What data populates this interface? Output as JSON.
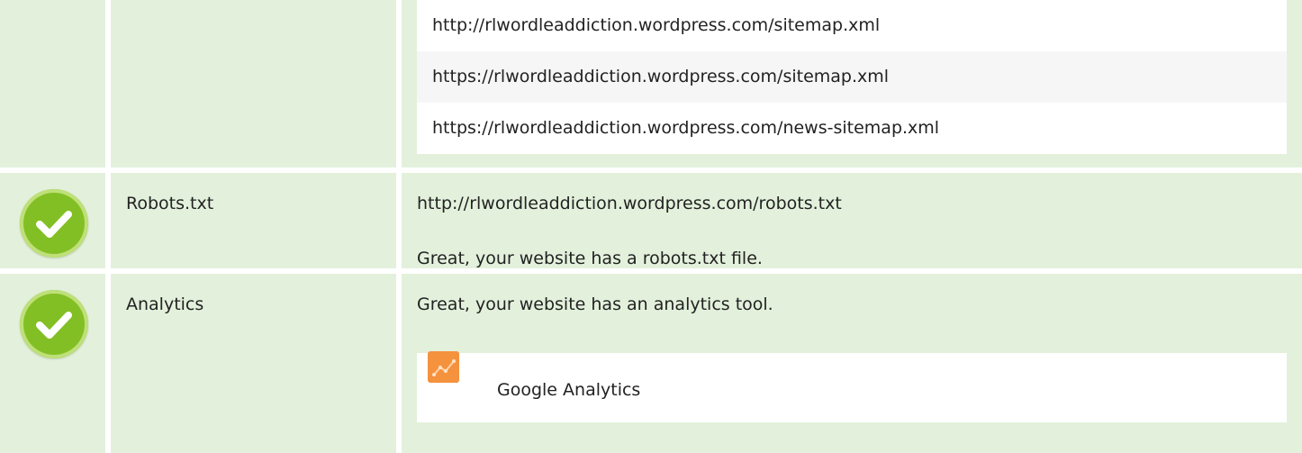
{
  "sitemaps": {
    "items": [
      "http://rlwordleaddiction.wordpress.com/sitemap.xml",
      "https://rlwordleaddiction.wordpress.com/sitemap.xml",
      "https://rlwordleaddiction.wordpress.com/news-sitemap.xml"
    ]
  },
  "robots": {
    "label": "Robots.txt",
    "url": "http://rlwordleaddiction.wordpress.com/robots.txt",
    "message": "Great, your website has a robots.txt file.",
    "status_icon": "check-icon"
  },
  "analytics": {
    "label": "Analytics",
    "message": "Great, your website has an analytics tool.",
    "status_icon": "check-icon",
    "tools": [
      {
        "name": "Google Analytics",
        "icon": "google-analytics-icon"
      }
    ]
  },
  "colors": {
    "row_background": "#e3f1dc",
    "check_green": "#82bf24",
    "analytics_orange": "#f5923e"
  }
}
